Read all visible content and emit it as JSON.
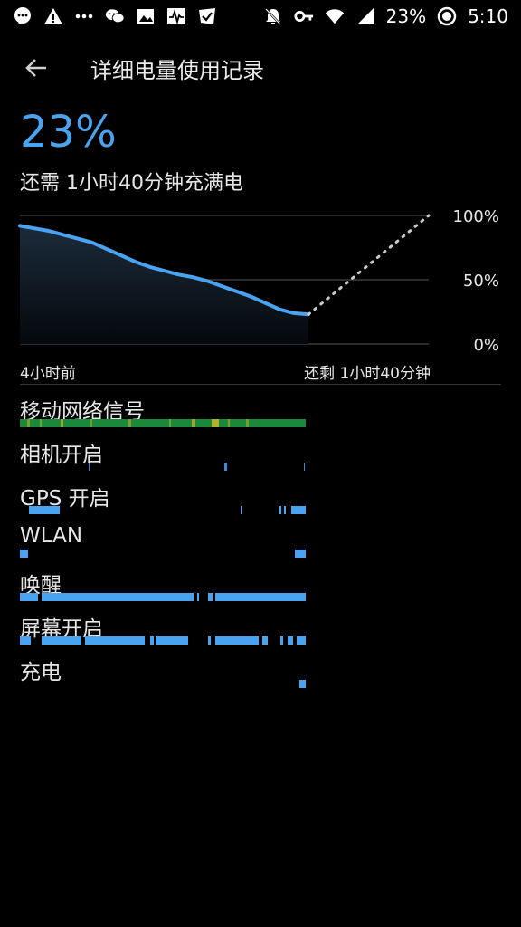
{
  "status_bar": {
    "battery": "23%",
    "time": "5:10",
    "left_icons": [
      "message-icon",
      "warning-icon",
      "more-icon",
      "wechat-icon",
      "image-icon",
      "activity-icon",
      "check-icon"
    ],
    "right_icons": [
      "notification-off-icon",
      "key-icon",
      "wifi-icon",
      "signal-icon",
      "battery-saver-icon"
    ]
  },
  "header": {
    "title": "详细电量使用记录"
  },
  "summary": {
    "percent": "23%",
    "remaining": "还需 1小时40分钟充满电"
  },
  "chart_data": {
    "type": "line",
    "title": "",
    "xlabel": "",
    "ylabel": "",
    "ylim": [
      0,
      100
    ],
    "y_tick_labels": [
      "100%",
      "50%",
      "0%"
    ],
    "x_labels": {
      "left": "4小时前",
      "right": "还剩 1小时40分钟"
    },
    "colors": {
      "line": "#4aa3f0",
      "projection": "#cccccc",
      "grid": "#3a3a3a"
    },
    "series": [
      {
        "x": [
          0,
          0.2,
          0.4,
          0.6,
          0.8,
          1.0,
          1.2,
          1.4,
          1.6,
          1.8,
          2.0,
          2.2,
          2.4,
          2.6,
          2.8,
          3.0,
          3.2,
          3.4,
          3.6,
          3.8,
          4.0
        ],
        "values": [
          92,
          90,
          88,
          85,
          82,
          79,
          74,
          69,
          64,
          60,
          57,
          54,
          52,
          49,
          45,
          41,
          37,
          32,
          27,
          24,
          23
        ]
      },
      {
        "x": [
          4.0,
          5.67
        ],
        "values": [
          23,
          100
        ],
        "style": "dotted"
      }
    ]
  },
  "rows": [
    {
      "label": "移动网络信号",
      "bar": "signal"
    },
    {
      "label": "相机开启",
      "bar": "ticks"
    },
    {
      "label": "GPS 开启",
      "bar": "ticks"
    },
    {
      "label": "WLAN",
      "bar": "ticks"
    },
    {
      "label": "唤醒",
      "bar": "solid"
    },
    {
      "label": "屏幕开启",
      "bar": "segments"
    },
    {
      "label": "充电",
      "bar": "ticks"
    }
  ]
}
